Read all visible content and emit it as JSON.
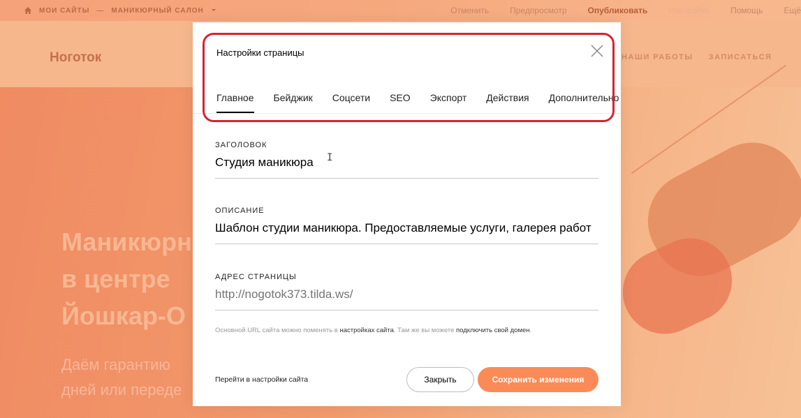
{
  "topbar": {
    "crumb_home": "МОИ САЙТЫ",
    "crumb_sep": "—",
    "crumb_site": "МАНИКЮРНЫЙ САЛОН",
    "nav": [
      "Отменить",
      "Предпросмотр",
      "Опубликовать",
      "Настройки",
      "Помощь",
      "Ещё"
    ]
  },
  "site": {
    "logo": "Ноготок",
    "nav": [
      "НАШИ РАБОТЫ",
      "ЗАПИСАТЬСЯ"
    ],
    "hero_title": [
      "Маникюрн",
      "в центре",
      "Йошкар-О"
    ],
    "hero_sub": [
      "Даём гарантию",
      "дней или переде"
    ]
  },
  "modal": {
    "title": "Настройки страницы",
    "tabs": [
      "Главное",
      "Бейджик",
      "Соцсети",
      "SEO",
      "Экспорт",
      "Действия",
      "Дополнительно"
    ],
    "active_tab": "Главное",
    "fields": {
      "title_label": "ЗАГОЛОВОК",
      "title_value": "Студия маникюра",
      "description_label": "ОПИСАНИЕ",
      "description_value": "Шаблон студии маникюра. Предоставляемые услуги, галерея работ",
      "url_label": "АДРЕС СТРАНИЦЫ",
      "url_placeholder": "http://nogotok373.tilda.ws/"
    },
    "hint": {
      "part1": "Основной URL сайта можно поменять в",
      "link1": "настройках сайта",
      "part2": ". Там же вы можете",
      "link2": "подключить свой домен",
      "part3": "."
    },
    "footer_link": "Перейти в настройки сайта",
    "close_button": "Закрыть",
    "save_button": "Сохранить изменения"
  },
  "colors": {
    "accent": "#fa8b57",
    "highlight": "#d8232f"
  }
}
